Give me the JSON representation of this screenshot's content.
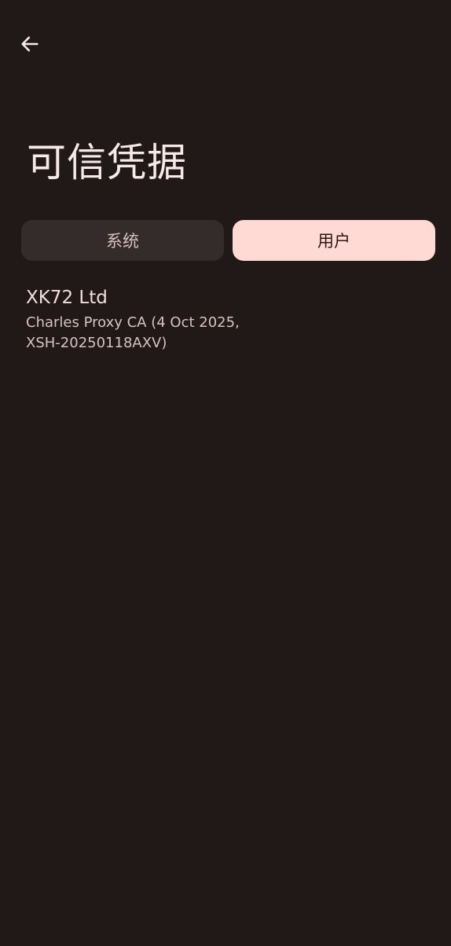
{
  "header": {
    "back_icon": "arrow-left-icon",
    "title": "可信凭据"
  },
  "tabs": [
    {
      "label": "系统",
      "selected": false
    },
    {
      "label": "用户",
      "selected": true
    }
  ],
  "certificates": [
    {
      "organization": "XK72 Ltd",
      "detail": "Charles Proxy CA (4 Oct 2025, XSH-20250118AXV)"
    }
  ],
  "colors": {
    "background": "#211918",
    "tab_selected": "#FFDAD5",
    "tab_unselected": "#342C2B"
  }
}
